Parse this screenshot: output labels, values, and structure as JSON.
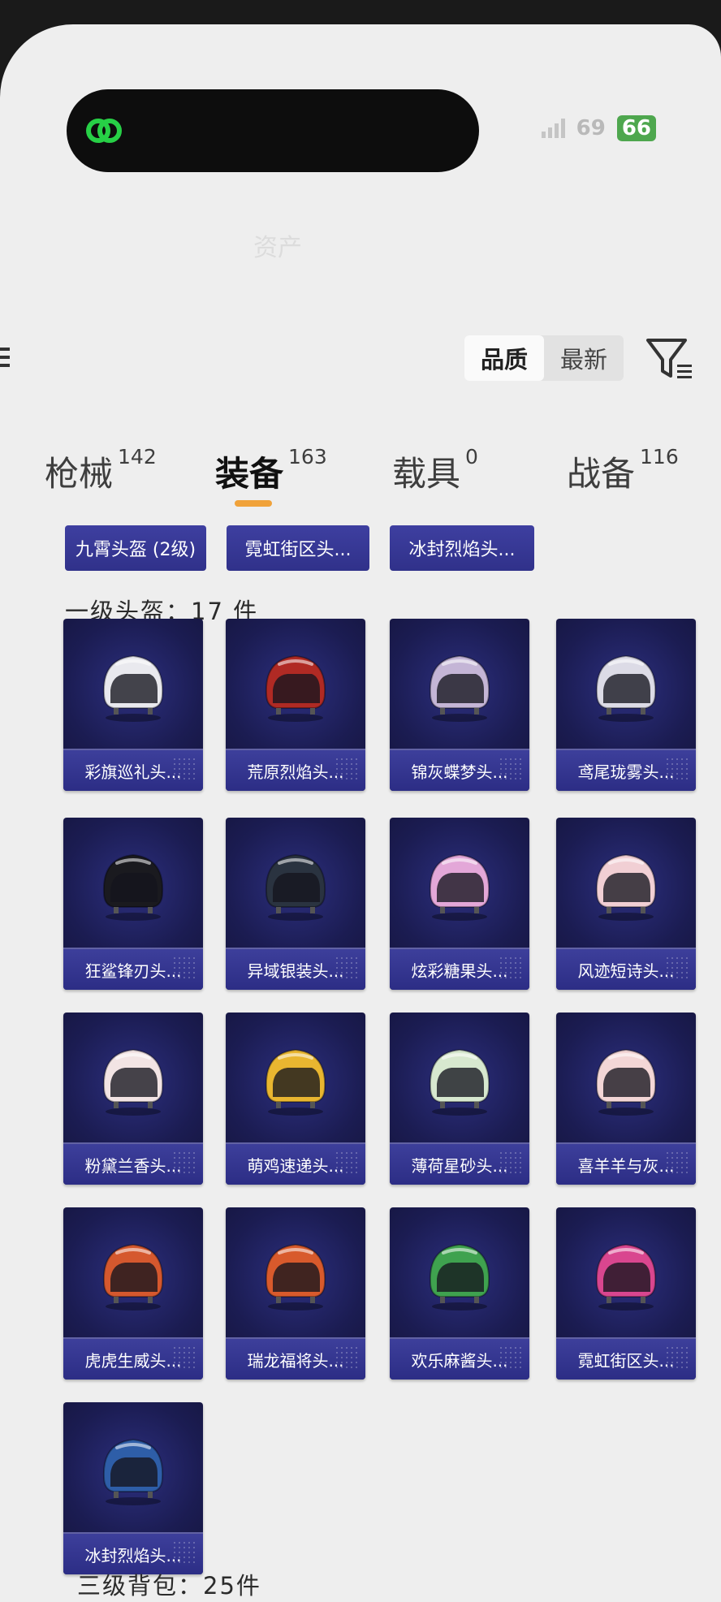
{
  "status_bar": {
    "signal_text": "69",
    "battery": "66"
  },
  "ghost_title": "资产",
  "sort": {
    "options": [
      "品质",
      "最新"
    ],
    "active": "品质"
  },
  "tabs": [
    {
      "label": "枪械",
      "count": "142"
    },
    {
      "label": "装备",
      "count": "163"
    },
    {
      "label": "载具",
      "count": "0"
    },
    {
      "label": "战备",
      "count": "116"
    }
  ],
  "active_tab": "装备",
  "chips": [
    "九霄头盔 (2级)",
    "霓虹街区头...",
    "冰封烈焰头..."
  ],
  "section": {
    "title": "一级头盔：",
    "count": "17 件"
  },
  "items": [
    {
      "name": "彩旗巡礼头...",
      "color": "#e9e9ee"
    },
    {
      "name": "荒原烈焰头...",
      "color": "#b02a24"
    },
    {
      "name": "锦灰蝶梦头...",
      "color": "#c4b5d6"
    },
    {
      "name": "鸢尾珑雾头...",
      "color": "#dcdbe6"
    },
    {
      "name": "狂鲨锋刃头...",
      "color": "#1a1a1f"
    },
    {
      "name": "异域银装头...",
      "color": "#2a3340"
    },
    {
      "name": "炫彩糖果头...",
      "color": "#e3a7d8"
    },
    {
      "name": "风迹短诗头...",
      "color": "#f1cfd4"
    },
    {
      "name": "粉黛兰香头...",
      "color": "#f2e4e4"
    },
    {
      "name": "萌鸡速递头...",
      "color": "#e9b630"
    },
    {
      "name": "薄荷星砂头...",
      "color": "#d7e8cf"
    },
    {
      "name": "喜羊羊与灰...",
      "color": "#f3d6d6"
    },
    {
      "name": "虎虎生威头...",
      "color": "#d5582e"
    },
    {
      "name": "瑞龙福将头...",
      "color": "#d85a2c"
    },
    {
      "name": "欢乐麻酱头...",
      "color": "#3fa24f"
    },
    {
      "name": "霓虹街区头...",
      "color": "#d9468f"
    },
    {
      "name": "冰封烈焰头...",
      "color": "#2e5ea8"
    }
  ],
  "next_section": {
    "title": "三级背包：",
    "count": "25件"
  }
}
